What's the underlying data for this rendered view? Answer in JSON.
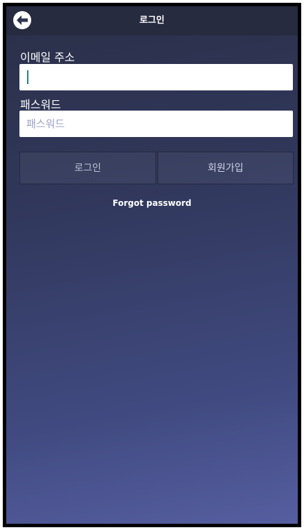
{
  "header": {
    "title": "로그인",
    "back_icon": "arrow-left-icon"
  },
  "form": {
    "email_label": "이메일 주소",
    "email_value": "",
    "email_placeholder": "",
    "password_label": "패스워드",
    "password_placeholder": "패스워드"
  },
  "buttons": {
    "login_label": "로그인",
    "signup_label": "회원가입"
  },
  "links": {
    "forgot_password": "Forgot password"
  },
  "colors": {
    "header_bg": "#272b40",
    "background_top": "#2b3048",
    "background_bottom": "#565ea0",
    "caret": "#1e8a7a"
  }
}
